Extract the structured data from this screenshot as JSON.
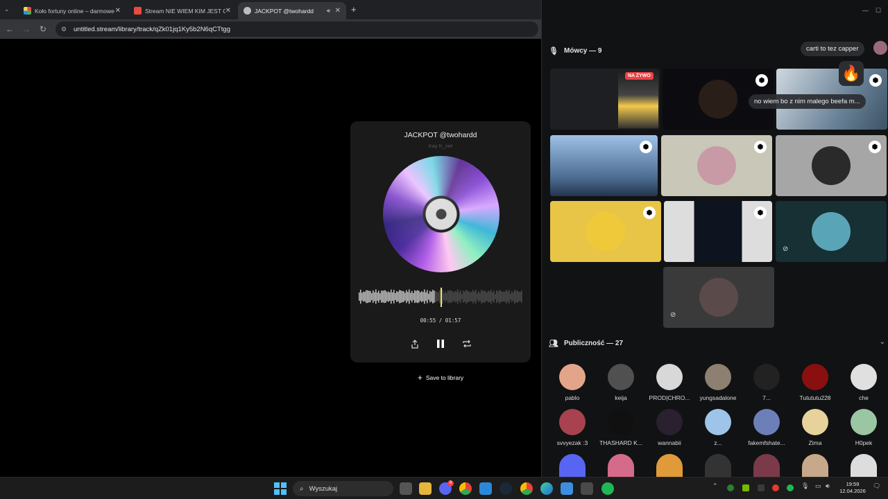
{
  "browser": {
    "tabs": [
      {
        "title": "Koło fortuny online – darmowe",
        "favicon_color": "#ffd54a",
        "active": false
      },
      {
        "title": "Stream NIE WIEM KIM JEST ON",
        "favicon_color": "#e94b3c",
        "active": false
      },
      {
        "title": "JACKPOT @twohardd",
        "favicon_color": "#bdbdbd",
        "active": true
      }
    ],
    "url": "untitled.stream/library/track/qZk01jq1Ky5b2N6qCTtgg"
  },
  "player": {
    "title": "JACKPOT @twohardd",
    "artist": "Kay K_net",
    "current_time": "00:55",
    "separator": "/",
    "duration": "01:57",
    "progress": 0.47,
    "save_label": "Save to library"
  },
  "stage": {
    "speakers_label": "Mówcy — 9",
    "audience_label": "Publiczność — 27",
    "live_label": "NA ŻYWO",
    "chat": [
      {
        "text": "carti to tez capper"
      },
      {
        "text": "no wiem bo z nim malego beefa m..."
      }
    ],
    "speakers": [
      {
        "name": "screen-share",
        "bg": "#1d1f22",
        "mod": false,
        "muted": false,
        "live": true
      },
      {
        "name": "dark-cam",
        "bg": "#0c0c10",
        "mod": true,
        "muted": false,
        "live": false
      },
      {
        "name": "bright-room",
        "bg": "#7a8da0",
        "mod": true,
        "muted": false,
        "live": false
      },
      {
        "name": "window-cam",
        "bg": "#4c6c92",
        "mod": true,
        "muted": false,
        "live": false
      },
      {
        "name": "avatar-bear",
        "bg": "#c9c7b8",
        "mod": true,
        "muted": false,
        "live": false
      },
      {
        "name": "avatar-dark-circle",
        "bg": "#a6a6a6",
        "mod": true,
        "muted": false,
        "live": false
      },
      {
        "name": "avatar-scream",
        "bg": "#e8c547",
        "mod": true,
        "muted": false,
        "live": false
      },
      {
        "name": "manga-night",
        "bg": "#2b2b2b",
        "mod": true,
        "muted": true,
        "live": false
      },
      {
        "name": "avatar-split",
        "bg": "#163034",
        "mod": false,
        "muted": true,
        "live": false
      },
      {
        "name": "avatar-red",
        "bg": "#3a3a3a",
        "mod": false,
        "muted": true,
        "live": false
      }
    ],
    "audience": [
      {
        "name": "pablo",
        "color": "#e3a58a"
      },
      {
        "name": "keija",
        "color": "#505050"
      },
      {
        "name": "PROD|CHRO...",
        "color": "#d8d8d8"
      },
      {
        "name": "yungsadalone",
        "color": "#8d8070"
      },
      {
        "name": "7...",
        "color": "#222222"
      },
      {
        "name": "Tutututu228",
        "color": "#8a1010"
      },
      {
        "name": "che",
        "color": "#e0e0e0"
      },
      {
        "name": "svvyezak :3",
        "color": "#a8424f"
      },
      {
        "name": "THASHARD K...",
        "color": "#101010"
      },
      {
        "name": "wannabii",
        "color": "#2a2030"
      },
      {
        "name": "z...",
        "color": "#9ec4e8"
      },
      {
        "name": "fakemfshate...",
        "color": "#6c7fb8"
      },
      {
        "name": "Zima",
        "color": "#e6d29a"
      },
      {
        "name": "H0pek",
        "color": "#9bc6a4"
      }
    ]
  },
  "taskbar": {
    "search_placeholder": "Wyszukaj",
    "time": "19:59",
    "date": "12.04.2026",
    "discord_badge": "9"
  }
}
